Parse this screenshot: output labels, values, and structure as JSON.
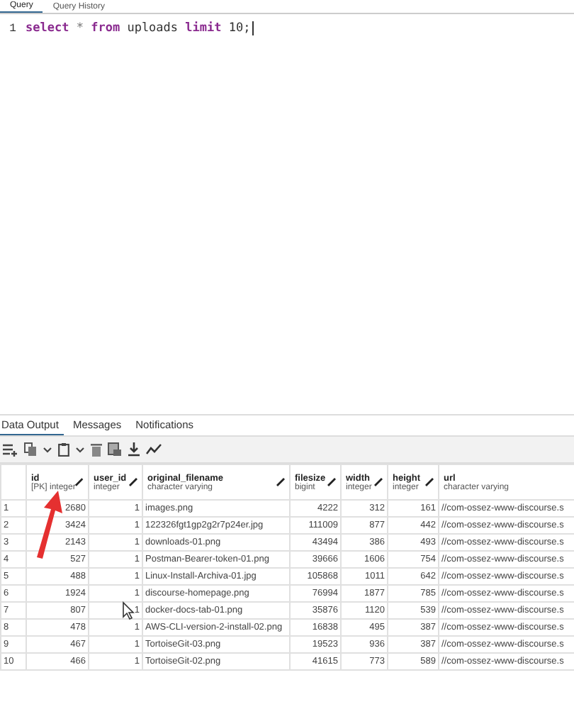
{
  "query_tabs": [
    {
      "label": "Query",
      "selected": true
    },
    {
      "label": "Query History",
      "selected": false
    }
  ],
  "editor": {
    "lines": [
      {
        "number": "1",
        "tokens": [
          {
            "text": "select",
            "kind": "keyword"
          },
          {
            "text": "*",
            "kind": "operator"
          },
          {
            "text": "from",
            "kind": "keyword"
          },
          {
            "text": "uploads",
            "kind": "plain"
          },
          {
            "text": "limit",
            "kind": "keyword"
          },
          {
            "text": "10;",
            "kind": "plain"
          }
        ]
      }
    ]
  },
  "output_tabs": [
    {
      "label": "Data Output",
      "selected": true
    },
    {
      "label": "Messages",
      "selected": false
    },
    {
      "label": "Notifications",
      "selected": false
    }
  ],
  "toolbar": [
    {
      "kind": "add-row"
    },
    {
      "kind": "copy"
    },
    {
      "kind": "caret"
    },
    {
      "kind": "paste"
    },
    {
      "kind": "caret"
    },
    {
      "kind": "delete"
    },
    {
      "kind": "save"
    },
    {
      "kind": "download"
    },
    {
      "kind": "graph"
    }
  ],
  "table": {
    "columns": [
      {
        "name": "id",
        "type": "[PK] integer",
        "editable": true,
        "kind": "number"
      },
      {
        "name": "user_id",
        "type": "integer",
        "editable": true,
        "kind": "number"
      },
      {
        "name": "original_filename",
        "type": "character varying",
        "editable": true,
        "kind": "text"
      },
      {
        "name": "filesize",
        "type": "bigint",
        "editable": true,
        "kind": "number"
      },
      {
        "name": "width",
        "type": "integer",
        "editable": true,
        "kind": "number"
      },
      {
        "name": "height",
        "type": "integer",
        "editable": true,
        "kind": "number"
      },
      {
        "name": "url",
        "type": "character varying",
        "editable": false,
        "kind": "text"
      }
    ],
    "rows": [
      {
        "number": "1",
        "cells": [
          "2680",
          "1",
          "images.png",
          "4222",
          "312",
          "161",
          "//com-ossez-www-discourse.s"
        ]
      },
      {
        "number": "2",
        "cells": [
          "3424",
          "1",
          "122326fgt1gp2g2r7p24er.jpg",
          "111009",
          "877",
          "442",
          "//com-ossez-www-discourse.s"
        ]
      },
      {
        "number": "3",
        "cells": [
          "2143",
          "1",
          "downloads-01.png",
          "43494",
          "386",
          "493",
          "//com-ossez-www-discourse.s"
        ]
      },
      {
        "number": "4",
        "cells": [
          "527",
          "1",
          "Postman-Bearer-token-01.png",
          "39666",
          "1606",
          "754",
          "//com-ossez-www-discourse.s"
        ]
      },
      {
        "number": "5",
        "cells": [
          "488",
          "1",
          "Linux-Install-Archiva-01.jpg",
          "105868",
          "1011",
          "642",
          "//com-ossez-www-discourse.s"
        ]
      },
      {
        "number": "6",
        "cells": [
          "1924",
          "1",
          "discourse-homepage.png",
          "76994",
          "1877",
          "785",
          "//com-ossez-www-discourse.s"
        ]
      },
      {
        "number": "7",
        "cells": [
          "807",
          "1",
          "docker-docs-tab-01.png",
          "35876",
          "1120",
          "539",
          "//com-ossez-www-discourse.s"
        ]
      },
      {
        "number": "8",
        "cells": [
          "478",
          "1",
          "AWS-CLI-version-2-install-02.png",
          "16838",
          "495",
          "387",
          "//com-ossez-www-discourse.s"
        ]
      },
      {
        "number": "9",
        "cells": [
          "467",
          "1",
          "TortoiseGit-03.png",
          "19523",
          "936",
          "387",
          "//com-ossez-www-discourse.s"
        ]
      },
      {
        "number": "10",
        "cells": [
          "466",
          "1",
          "TortoiseGit-02.png",
          "41615",
          "773",
          "589",
          "//com-ossez-www-discourse.s"
        ]
      }
    ]
  }
}
